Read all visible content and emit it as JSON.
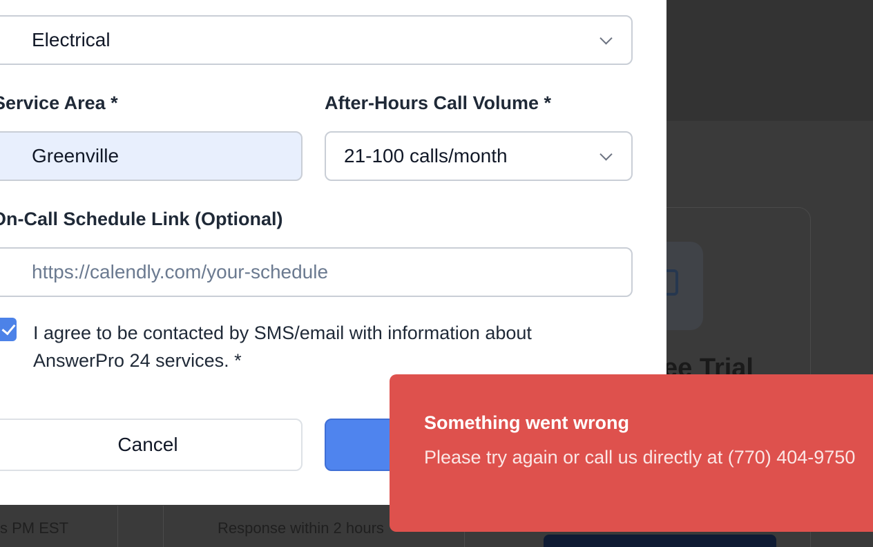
{
  "background": {
    "trial_title": "ee Trial",
    "row_cell_1": "s PM EST",
    "row_cell_2": "Response within 2 hours"
  },
  "form": {
    "industry": {
      "value": "Electrical"
    },
    "service_area": {
      "label": "Service Area *",
      "value": "Greenville"
    },
    "call_volume": {
      "label": "After-Hours Call Volume *",
      "value": "21-100 calls/month"
    },
    "schedule_link": {
      "label": "On-Call Schedule Link (Optional)",
      "placeholder": "https://calendly.com/your-schedule",
      "value": ""
    },
    "consent": {
      "checked": true,
      "text": "I agree to be contacted by SMS/email with information about AnswerPro 24 services. *"
    },
    "cancel_label": "Cancel"
  },
  "toast": {
    "title": "Something went wrong",
    "message": "Please try again or call us directly at (770) 404-9750",
    "color": "#de514d"
  },
  "colors": {
    "accent": "#4f84ee",
    "filled_field": "#e8effd",
    "overlay": "#3a3a3a"
  }
}
